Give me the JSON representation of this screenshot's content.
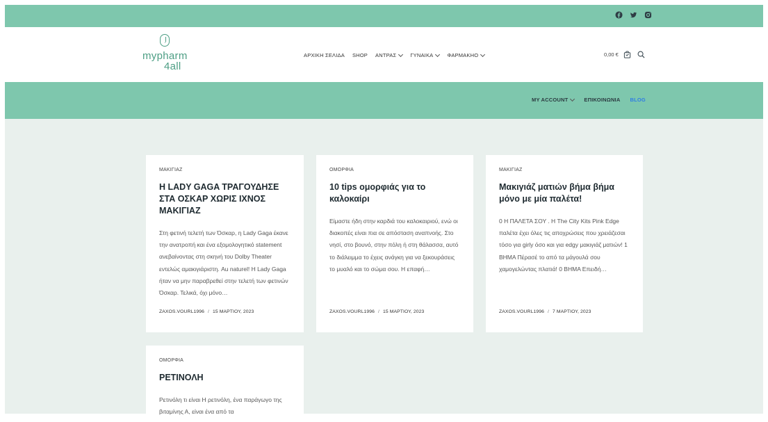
{
  "topbar": {
    "socials": [
      "facebook-icon",
      "twitter-icon",
      "instagram-icon"
    ],
    "color": "#7ec7ad"
  },
  "header": {
    "logo": {
      "line1": "mypharm",
      "line2": "4all"
    },
    "nav": [
      {
        "label": "ΑΡΧΙΚΗ ΣΕΛΙΔΑ",
        "dropdown": false
      },
      {
        "label": "SHOP",
        "dropdown": false
      },
      {
        "label": "ΑΝΤΡΑΣ",
        "dropdown": true
      },
      {
        "label": "ΓΥΝΑΙΚΑ",
        "dropdown": true
      },
      {
        "label": "ΦΑΡΜΑΚΗΟ",
        "dropdown": true
      }
    ],
    "cart_total": "0,00 €"
  },
  "subnav": {
    "items": [
      {
        "label": "MY ACCOUNT",
        "dropdown": true
      },
      {
        "label": "ΕΠΙΚΟΙΝΩΝΙΑ",
        "dropdown": false
      },
      {
        "label": "BLOG",
        "dropdown": false,
        "active": true
      }
    ],
    "active_color": "#2f7de3"
  },
  "posts": [
    {
      "category": "ΜΑΚΙΓΙΑΖ",
      "title": "Η LADY GAGA ΤΡΑΓΟΥΔΗΣΕ ΣΤΑ ΟΣΚΑΡ ΧΩΡΙΣ ΙΧΝΟΣ ΜΑΚΙΓΙΑΖ",
      "excerpt": "Στη φετινή τελετή των Όσκαρ, η Lady Gaga έκανε την ανατροπή και ένα εξομολογητικό statement ανεβαίνοντας στη σκηνή του Dolby Theater εντελώς αμακιγιάριστη. Au naturel! Η Lady Gaga ήταν να μην παραβρεθεί στην τελετή των φετινών Όσκαρ. Τελικά, όχι μόνο…",
      "author": "ZAXOS.VOURL1996",
      "date": "15 ΜΑΡΤΙΟΥ, 2023"
    },
    {
      "category": "ΟΜΟΡΦΙΑ",
      "title": "10 tips ομορφιάς για το καλοκαίρι",
      "excerpt": "Είμαστε ήδη στην καρδιά του καλοκαιριού, ενώ οι διακοπές είναι πια σε απόσταση αναπνοής. Στο νησί, στο βουνό, στην πόλη ή στη θάλασσα, αυτό το διάλειμμα το έχεις ανάγκη για να ξεκουράσεις το μυαλό και το σώμα σου. Η επαφή…",
      "author": "ZAXOS.VOURL1996",
      "date": "15 ΜΑΡΤΙΟΥ, 2023"
    },
    {
      "category": "ΜΑΚΙΓΙΑΖ",
      "title": "Μακιγιάζ ματιών βήμα βήμα μόνο με μία παλέτα!",
      "excerpt": "0 Η ΠΑΛΕΤΑ ΣΟΥ . Η The City Kits Pink Edge παλέτα έχει όλες τις αποχρώσεις που χρειάζεσαι τόσο για girly όσο και για edgy μακιγιάζ ματιών! 1 ΒΗΜΑ Πέρασέ το από τα μάγουλά σου χαμογελώντας πλατιά! 0 ΒΗΜΑ Επειδή…",
      "author": "ZAXOS.VOURL1996",
      "date": "7 ΜΑΡΤΙΟΥ, 2023"
    },
    {
      "category": "ΟΜΟΡΦΙΑ",
      "title": "ΡΕΤΙΝΟΛΗ",
      "excerpt": "Ρετινόλη τι είναι Η ρετινόλη, ένα παράγωγο της βιταμίνης Α, είναι ένα από τα",
      "author": "",
      "date": ""
    }
  ]
}
